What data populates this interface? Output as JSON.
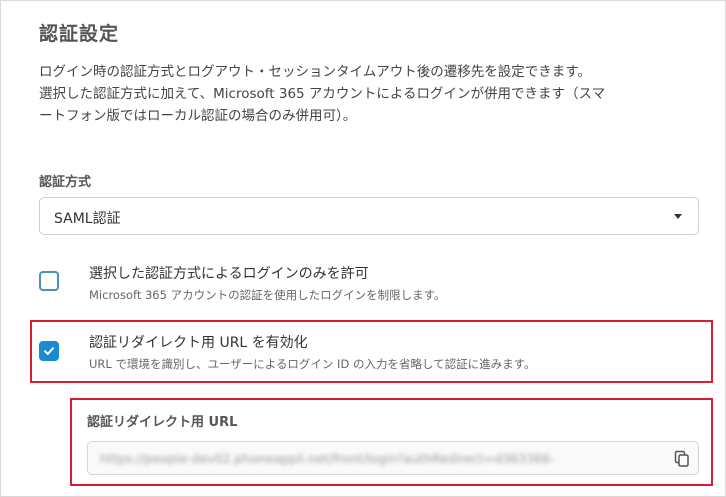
{
  "page": {
    "title": "認証設定",
    "description_lines": [
      "ログイン時の認証方式とログアウト・セッションタイムアウト後の遷移先を設定できます。",
      "選択した認証方式に加えて、Microsoft 365 アカウントによるログインが併用できます（スマ",
      "ートフォン版ではローカル認証の場合のみ併用可）。"
    ]
  },
  "auth_method": {
    "label": "認証方式",
    "selected": "SAML認証"
  },
  "options": [
    {
      "label": "選択した認証方式によるログインのみを許可",
      "description": "Microsoft 365 アカウントの認証を使用したログインを制限します。",
      "checked": false
    },
    {
      "label": "認証リダイレクト用 URL を有効化",
      "description": "URL で環境を識別し、ユーザーによるログイン ID の入力を省略して認証に進みます。",
      "checked": true
    }
  ],
  "redirect_url": {
    "label": "認証リダイレクト用 URL",
    "value": "https://people-dev02.phoneappli.net/front/login?authRedirect=d363366-"
  },
  "colors": {
    "accent": "#1a8bd1",
    "highlight": "#d81e33"
  },
  "icons": {
    "checkmark": "check-icon",
    "dropdown": "chevron-down-icon",
    "copy": "copy-icon"
  }
}
